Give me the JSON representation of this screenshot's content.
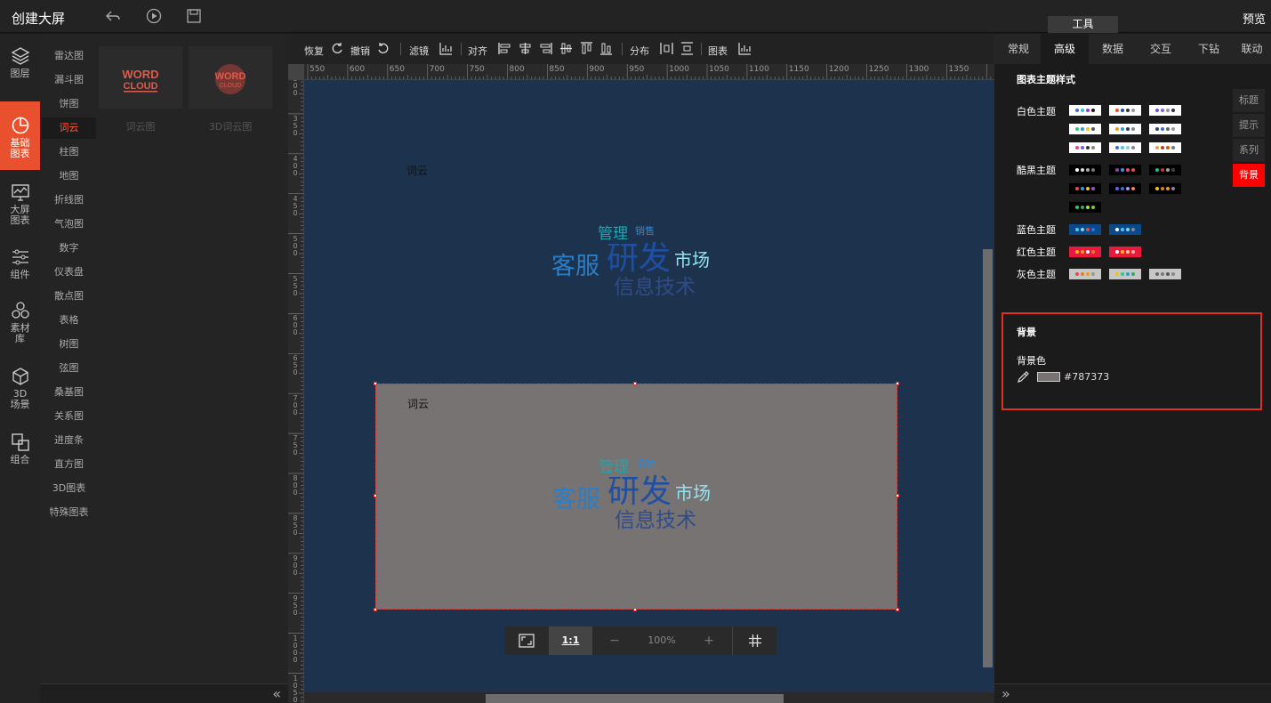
{
  "app": {
    "title": "创建大屏",
    "preview": "预览",
    "tools_tab": "工具"
  },
  "leftnav": [
    {
      "label": "图层",
      "icon": "layers-icon"
    },
    {
      "label": "基础图表",
      "icon": "pie-chart-icon",
      "active": true
    },
    {
      "label": "大屏图表",
      "icon": "monitor-chart-icon"
    },
    {
      "label": "组件",
      "icon": "sliders-icon"
    },
    {
      "label": "素材库",
      "icon": "hexagons-icon"
    },
    {
      "label": "3D场景",
      "icon": "cube-icon"
    },
    {
      "label": "组合",
      "icon": "combine-icon"
    }
  ],
  "sublist": [
    "雷达图",
    "漏斗图",
    "饼图",
    "词云",
    "柱图",
    "地图",
    "折线图",
    "气泡图",
    "数字",
    "仪表盘",
    "散点图",
    "表格",
    "树图",
    "弦图",
    "桑基图",
    "关系图",
    "进度条",
    "直方图",
    "3D图表",
    "特殊图表"
  ],
  "sublist_active": "词云",
  "thumbs": [
    {
      "label": "词云图",
      "word": "WORD",
      "cloud": "CLOUD"
    },
    {
      "label": "3D词云图",
      "word": "WORD",
      "cloud": "CLOUD"
    }
  ],
  "toolbar": {
    "redo": "恢复",
    "undo": "撤销",
    "filter": "滤镜",
    "align": "对齐",
    "distribute": "分布",
    "chart": "图表"
  },
  "ruler_h": [
    "550",
    "600",
    "650",
    "700",
    "750",
    "800",
    "850",
    "900",
    "950",
    "1000",
    "1050",
    "1100",
    "1150",
    "1200",
    "1250",
    "1300",
    "1350"
  ],
  "ruler_v": [
    "300",
    "350",
    "400",
    "450",
    "500",
    "550",
    "600",
    "650",
    "700",
    "750",
    "800",
    "850",
    "900",
    "950",
    "1000",
    "1050"
  ],
  "widgets": [
    {
      "title": "词云"
    },
    {
      "title": "词云"
    }
  ],
  "wordcloud": [
    {
      "text": "管理",
      "color": "#1aa7b2"
    },
    {
      "text": "销售",
      "color": "#2b88d8"
    },
    {
      "text": "研发",
      "color": "#1f4fa3"
    },
    {
      "text": "市场",
      "color": "#8fe6f0"
    },
    {
      "text": "客服",
      "color": "#2c7dc4"
    },
    {
      "text": "信息技术",
      "color": "#2f4c8a"
    }
  ],
  "zoom": {
    "ratio": "1:1",
    "minus": "−",
    "value": "100%",
    "plus": "+"
  },
  "rightpanel": {
    "tabs": [
      "常规",
      "高级",
      "数据",
      "交互",
      "下钻",
      "联动"
    ],
    "active_tab": "高级",
    "theme_heading": "图表主题样式",
    "themes": [
      {
        "label": "白色主题",
        "swatches": [
          [
            "#3a6fd8",
            "#34c3c7",
            "#8a3fd8",
            "#1a1a1a"
          ],
          [
            "#e8502e",
            "#1f4fa3",
            "#333",
            "#999"
          ],
          [
            "#6a5acd",
            "#7b68ee",
            "#8a8ad8",
            "#333"
          ],
          [
            "#2ecc71",
            "#3498db",
            "#f1c40f",
            "#555"
          ],
          [
            "#f39c12",
            "#3498db",
            "#2c3e50",
            "#888"
          ],
          [
            "#34495e",
            "#3a6fd8",
            "#666",
            "#999"
          ],
          [
            "#e84393",
            "#6c5ce7",
            "#2d3436",
            "#888"
          ],
          [
            "#3a6fd8",
            "#55c3f0",
            "#7ed6df",
            "#888"
          ],
          [
            "#e8a33a",
            "#c0392b",
            "#d35400",
            "#777"
          ]
        ],
        "bg": "#ffffff"
      },
      {
        "label": "酷黑主题",
        "swatches": [
          [
            "#fff",
            "#ddd",
            "#aaa",
            "#777"
          ],
          [
            "#8e44ad",
            "#3498db",
            "#e84393",
            "#e74c3c"
          ],
          [
            "#1abc9c",
            "#c0392b",
            "#95a5a6",
            "#444"
          ],
          [
            "#e74c3c",
            "#3498db",
            "#f1c40f",
            "#9b59b6"
          ],
          [
            "#6c5ce7",
            "#3a6fd8",
            "#a29bfe",
            "#ff7675"
          ],
          [
            "#f1c40f",
            "#e67e22",
            "#f39c12",
            "#888"
          ],
          [
            "#2ecc71",
            "#27ae60",
            "#a3e635",
            "#84cc16"
          ]
        ],
        "bg": "#000000"
      },
      {
        "label": "蓝色主题",
        "swatches": [
          [
            "#55c3f0",
            "#7ed6df",
            "#e74c3c",
            "#3a6fd8"
          ],
          [
            "#ffffff",
            "#55c3f0",
            "#7ed6df",
            "#888"
          ]
        ],
        "bg": "#0b4a8a"
      },
      {
        "label": "红色主题",
        "swatches": [
          [
            "#f1c40f",
            "#f39c12",
            "#ffffff",
            "#e67e22"
          ],
          [
            "#ffffff",
            "#f1c40f",
            "#fdcb6e",
            "#fab1a0"
          ]
        ],
        "bg": "#e8193c"
      },
      {
        "label": "灰色主题",
        "swatches": [
          [
            "#e74c3c",
            "#e67e22",
            "#f39c12",
            "#999"
          ],
          [
            "#f1c40f",
            "#2ecc71",
            "#3498db",
            "#27ae60"
          ],
          [
            "#666",
            "#777",
            "#555",
            "#888"
          ]
        ],
        "bg": "#c7c7c7"
      }
    ],
    "side_tabs": [
      "标题",
      "提示",
      "系列",
      "背景"
    ],
    "side_active": "背景",
    "background": {
      "title": "背景",
      "color_label": "背景色",
      "color_value": "#787373"
    }
  }
}
